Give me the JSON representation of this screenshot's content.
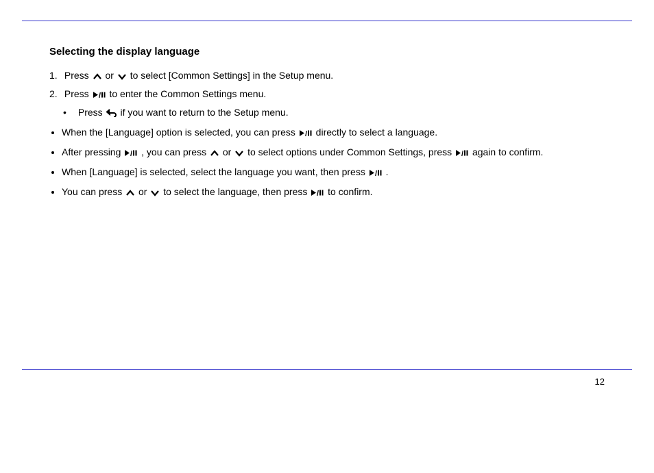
{
  "section": {
    "title": "Selecting the display language"
  },
  "steps": [
    {
      "num": "1.",
      "pre": "Press ",
      "mid": " or ",
      "post": " to select [Common Settings] in the Setup menu."
    },
    {
      "num": "2.",
      "pre": "Press ",
      "post": " to enter the Common Settings menu."
    },
    {
      "num": "•",
      "pre": "Press ",
      "post": " if you want to return to the Setup menu."
    }
  ],
  "bullets": [
    {
      "text_a": "When the [Language] option is selected, you can press ",
      "text_b": " directly to select a language."
    },
    {
      "text_a": "After pressing ",
      "text_b": ", you can press ",
      "text_c": " or ",
      "text_d": " to select options under Common Settings, press ",
      "text_e": " again to confirm."
    },
    {
      "text_a": "When [Language] is selected, select the language you want, then press ",
      "text_b": "."
    },
    {
      "text_a": "You can press ",
      "text_b": " or ",
      "text_c": " to select the language, then press ",
      "text_d": " to confirm."
    }
  ],
  "page_number": "12"
}
